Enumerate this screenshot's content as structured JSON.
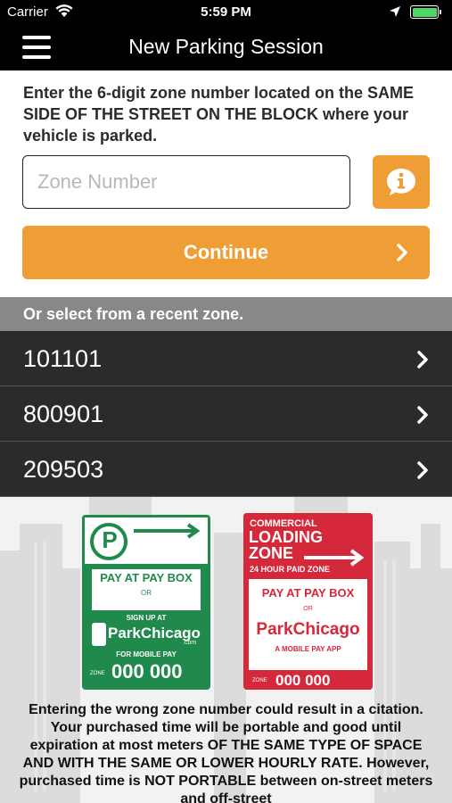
{
  "status_bar": {
    "carrier": "Carrier",
    "time": "5:59 PM",
    "battery_color": "#4cd964"
  },
  "nav_bar": {
    "title": "New Parking Session",
    "menu_icon": "hamburger-icon"
  },
  "instructions": "Enter the 6-digit zone number located on the SAME SIDE OF THE STREET ON THE BLOCK where your vehicle is parked.",
  "zone_input": {
    "value": "",
    "placeholder": "Zone Number"
  },
  "info_button": {
    "icon": "info-icon"
  },
  "continue_button": {
    "label": "Continue"
  },
  "recent": {
    "header": "Or select from a recent zone.",
    "items": [
      {
        "zone": "101101"
      },
      {
        "zone": "800901"
      },
      {
        "zone": "209503"
      }
    ]
  },
  "signs": {
    "green": {
      "symbol": "P",
      "pay_text": "PAY AT PAY BOX",
      "or": "OR",
      "signup": "SIGN UP AT",
      "brand": "ParkChicago",
      "brand_sub": ".com",
      "mobile": "FOR MOBILE PAY",
      "zone_label": "ZONE",
      "zone_number": "000 000"
    },
    "red": {
      "line1": "COMMERCIAL",
      "line2": "LOADING",
      "line3": "ZONE",
      "hours": "24 HOUR PAID ZONE",
      "pay_text": "PAY AT PAY BOX",
      "or": "OR",
      "brand": "ParkChicago",
      "app": "A MOBILE PAY APP",
      "zone_label": "ZONE",
      "zone_number": "000 000"
    }
  },
  "notice": "Entering the wrong zone number could result in a citation. Your purchased time will be portable and good until expiration at most meters OF THE SAME TYPE OF SPACE AND WITH THE SAME OR LOWER HOURLY RATE. However, purchased time is NOT PORTABLE between on-street meters and off-street",
  "colors": {
    "accent": "#ee9e34",
    "list_bg": "#2b2b2b",
    "header_gray": "#888888",
    "sign_green": "#1f8a4c",
    "sign_red": "#d6283b"
  }
}
